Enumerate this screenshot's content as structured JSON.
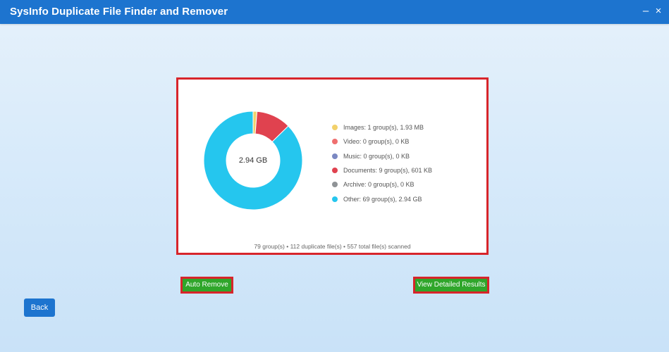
{
  "window": {
    "title": "SysInfo Duplicate File Finder and Remover",
    "minimize_glyph": "–",
    "close_glyph": "×"
  },
  "chart_data": {
    "type": "pie",
    "center_label": "2.94 GB",
    "categories": [
      "Images",
      "Video",
      "Music",
      "Documents",
      "Archive",
      "Other"
    ],
    "legend": [
      "Images: 1 group(s), 1.93 MB",
      "Video: 0 group(s), 0 KB",
      "Music: 0 group(s), 0 KB",
      "Documents: 9 group(s), 601 KB",
      "Archive: 0 group(s), 0 KB",
      "Other: 69 group(s), 2.94 GB"
    ],
    "colors": [
      "#f2d16b",
      "#ef6f6f",
      "#7b88c2",
      "#e0424f",
      "#8f9396",
      "#25c6ee"
    ],
    "groups": [
      1,
      0,
      0,
      9,
      0,
      69
    ]
  },
  "summary": "79 group(s) • 112 duplicate file(s) • 557 total file(s) scanned",
  "buttons": {
    "auto_remove": "Auto Remove",
    "view_results": "View Detailed Results",
    "back": "Back"
  }
}
